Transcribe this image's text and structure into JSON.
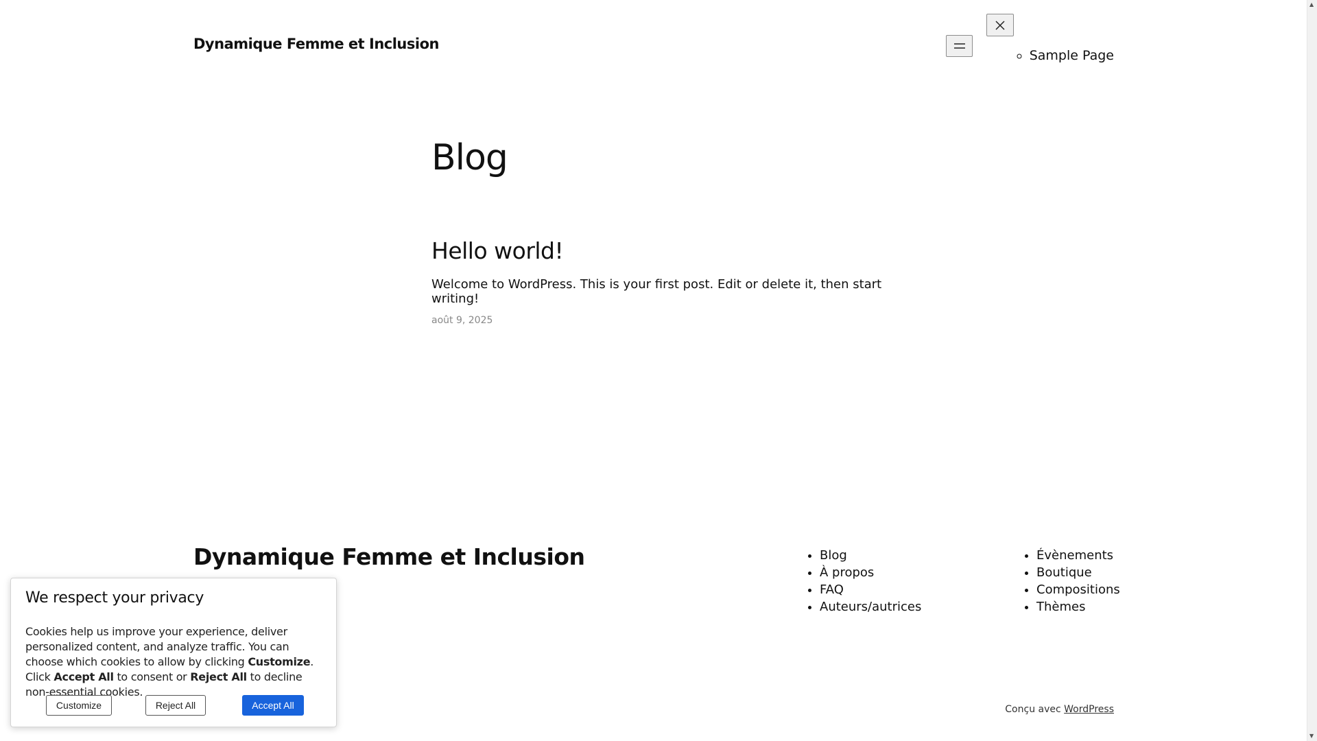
{
  "header": {
    "site_title": "Dynamique Femme et Inclusion",
    "menu_open_icon": "hamburger-icon",
    "menu_close_icon": "close-icon",
    "nav_items": [
      "Sample Page"
    ]
  },
  "main": {
    "heading": "Blog",
    "post": {
      "title": "Hello world!",
      "excerpt": "Welcome to WordPress. This is your first post. Edit or delete it, then start writing!",
      "date": "août 9, 2025"
    }
  },
  "footer": {
    "site_title": "Dynamique Femme et Inclusion",
    "nav_col1": [
      "Blog",
      "À propos",
      "FAQ",
      "Auteurs/autrices"
    ],
    "nav_col2": [
      "Évènements",
      "Boutique",
      "Compositions",
      "Thèmes"
    ],
    "credit_prefix": "Conçu avec",
    "credit_link": "WordPress"
  },
  "cookie_banner": {
    "title": "We respect your privacy",
    "text_part1": "Cookies help us improve your experience, deliver personalized content, and analyze traffic. You can choose which cookies to allow by clicking ",
    "text_bold1": "Customize",
    "text_part2": ". Click ",
    "text_bold2": "Accept All",
    "text_part3": " to consent or ",
    "text_bold3": "Reject All",
    "text_part4": " to decline non-essential cookies.",
    "customize_label": "Customize",
    "reject_label": "Reject All",
    "accept_label": "Accept All",
    "accept_color": "#1863dc"
  }
}
